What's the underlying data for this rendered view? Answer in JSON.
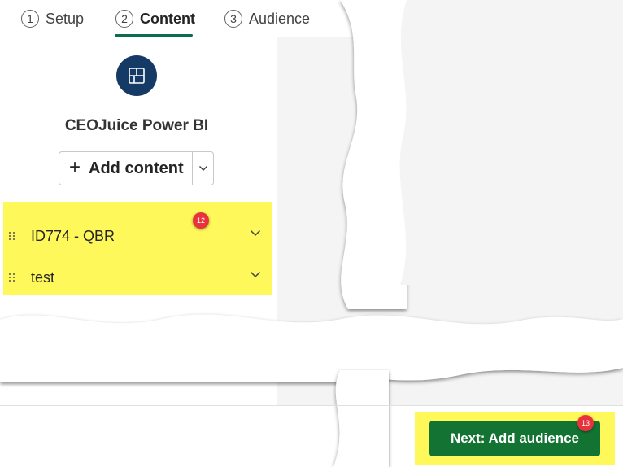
{
  "stepper": {
    "steps": [
      {
        "number": "1",
        "label": "Setup"
      },
      {
        "number": "2",
        "label": "Content"
      },
      {
        "number": "3",
        "label": "Audience"
      }
    ],
    "active_step": "Content"
  },
  "app": {
    "name": "CEOJuice Power BI",
    "logo_icon": "layout-grid-icon",
    "logo_color": "#163a66"
  },
  "add_content": {
    "label": "Add content",
    "icon": "plus-icon",
    "dropdown_icon": "chevron-down-icon"
  },
  "content_items": [
    {
      "label": "ID774 - QBR"
    },
    {
      "label": "test"
    }
  ],
  "annotations": {
    "badge_list": "12",
    "badge_next": "13",
    "highlight_color": "#fff85a",
    "badge_color": "#e8333c"
  },
  "footer": {
    "next_label": "Next: Add audience",
    "next_color": "#137333"
  }
}
